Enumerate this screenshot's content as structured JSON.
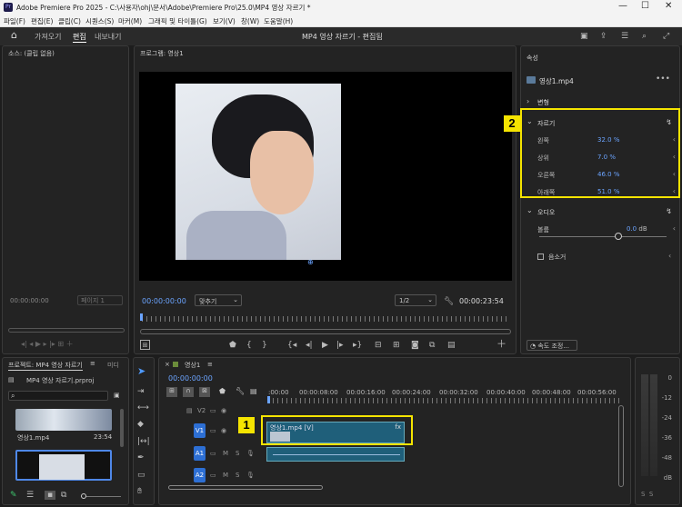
{
  "window": {
    "title": "Adobe Premiere Pro 2025 - C:\\사용자\\ohj\\문서\\Adobe\\Premiere Pro\\25.0\\MP4 영상 자르기 *",
    "app_icon": "Pr"
  },
  "menu": [
    "파일(F)",
    "편집(E)",
    "클립(C)",
    "시퀀스(S)",
    "마커(M)",
    "그래픽 및 타이틀(G)",
    "보기(V)",
    "창(W)",
    "도움말(H)"
  ],
  "header": {
    "tabs": [
      "가져오기",
      "편집",
      "내보내기"
    ],
    "active_tab": "편집",
    "doc_title": "MP4 영상 자르기 - 편집됨"
  },
  "source_panel": {
    "title": "소스: (클립 없음)",
    "timecode": "00:00:00:00",
    "page": "페이지 1"
  },
  "program_panel": {
    "title": "프로그램: 영상1",
    "timecode": "00:00:00:00",
    "fit": "맞추기",
    "quality": "1/2",
    "duration": "00:00:23:54"
  },
  "properties": {
    "title": "속성",
    "clip_name": "영상1.mp4",
    "transform_label": "변형",
    "crop_label": "자르기",
    "crop_rows": [
      {
        "label": "왼쪽",
        "value": "32.0",
        "unit": "%"
      },
      {
        "label": "상위",
        "value": "7.0",
        "unit": "%"
      },
      {
        "label": "오른쪽",
        "value": "46.0",
        "unit": "%"
      },
      {
        "label": "아래쪽",
        "value": "51.0",
        "unit": "%"
      }
    ],
    "audio_label": "오디오",
    "volume_label": "볼륨",
    "volume_value": "0.0",
    "volume_unit": "dB",
    "mute_label": "음소거",
    "speed_button": "속도 조정...",
    "volume_level": 0.62
  },
  "project_panel": {
    "title": "프로젝트: MP4 영상 자르기",
    "next_tab": "미디",
    "file": "MP4 영상 자르기.prproj",
    "clip_name": "영상1.mp4",
    "clip_duration": "23:54"
  },
  "timeline": {
    "tab": "영상1",
    "timecode": "00:00:00:00",
    "ruler_labels": [
      ":00:00",
      "00:00:08:00",
      "00:00:16:00",
      "00:00:24:00",
      "00:00:32:00",
      "00:00:40:00",
      "00:00:48:00",
      "00:00:56:00"
    ],
    "tracks": [
      "V2",
      "V1",
      "A1",
      "A2"
    ],
    "video_clip": "영상1.mp4 [V]",
    "fx": "fx",
    "callout1": "1",
    "callout2": "2"
  },
  "meter": {
    "labels": [
      "0",
      "-12",
      "-24",
      "-36",
      "-48",
      "dB"
    ]
  }
}
